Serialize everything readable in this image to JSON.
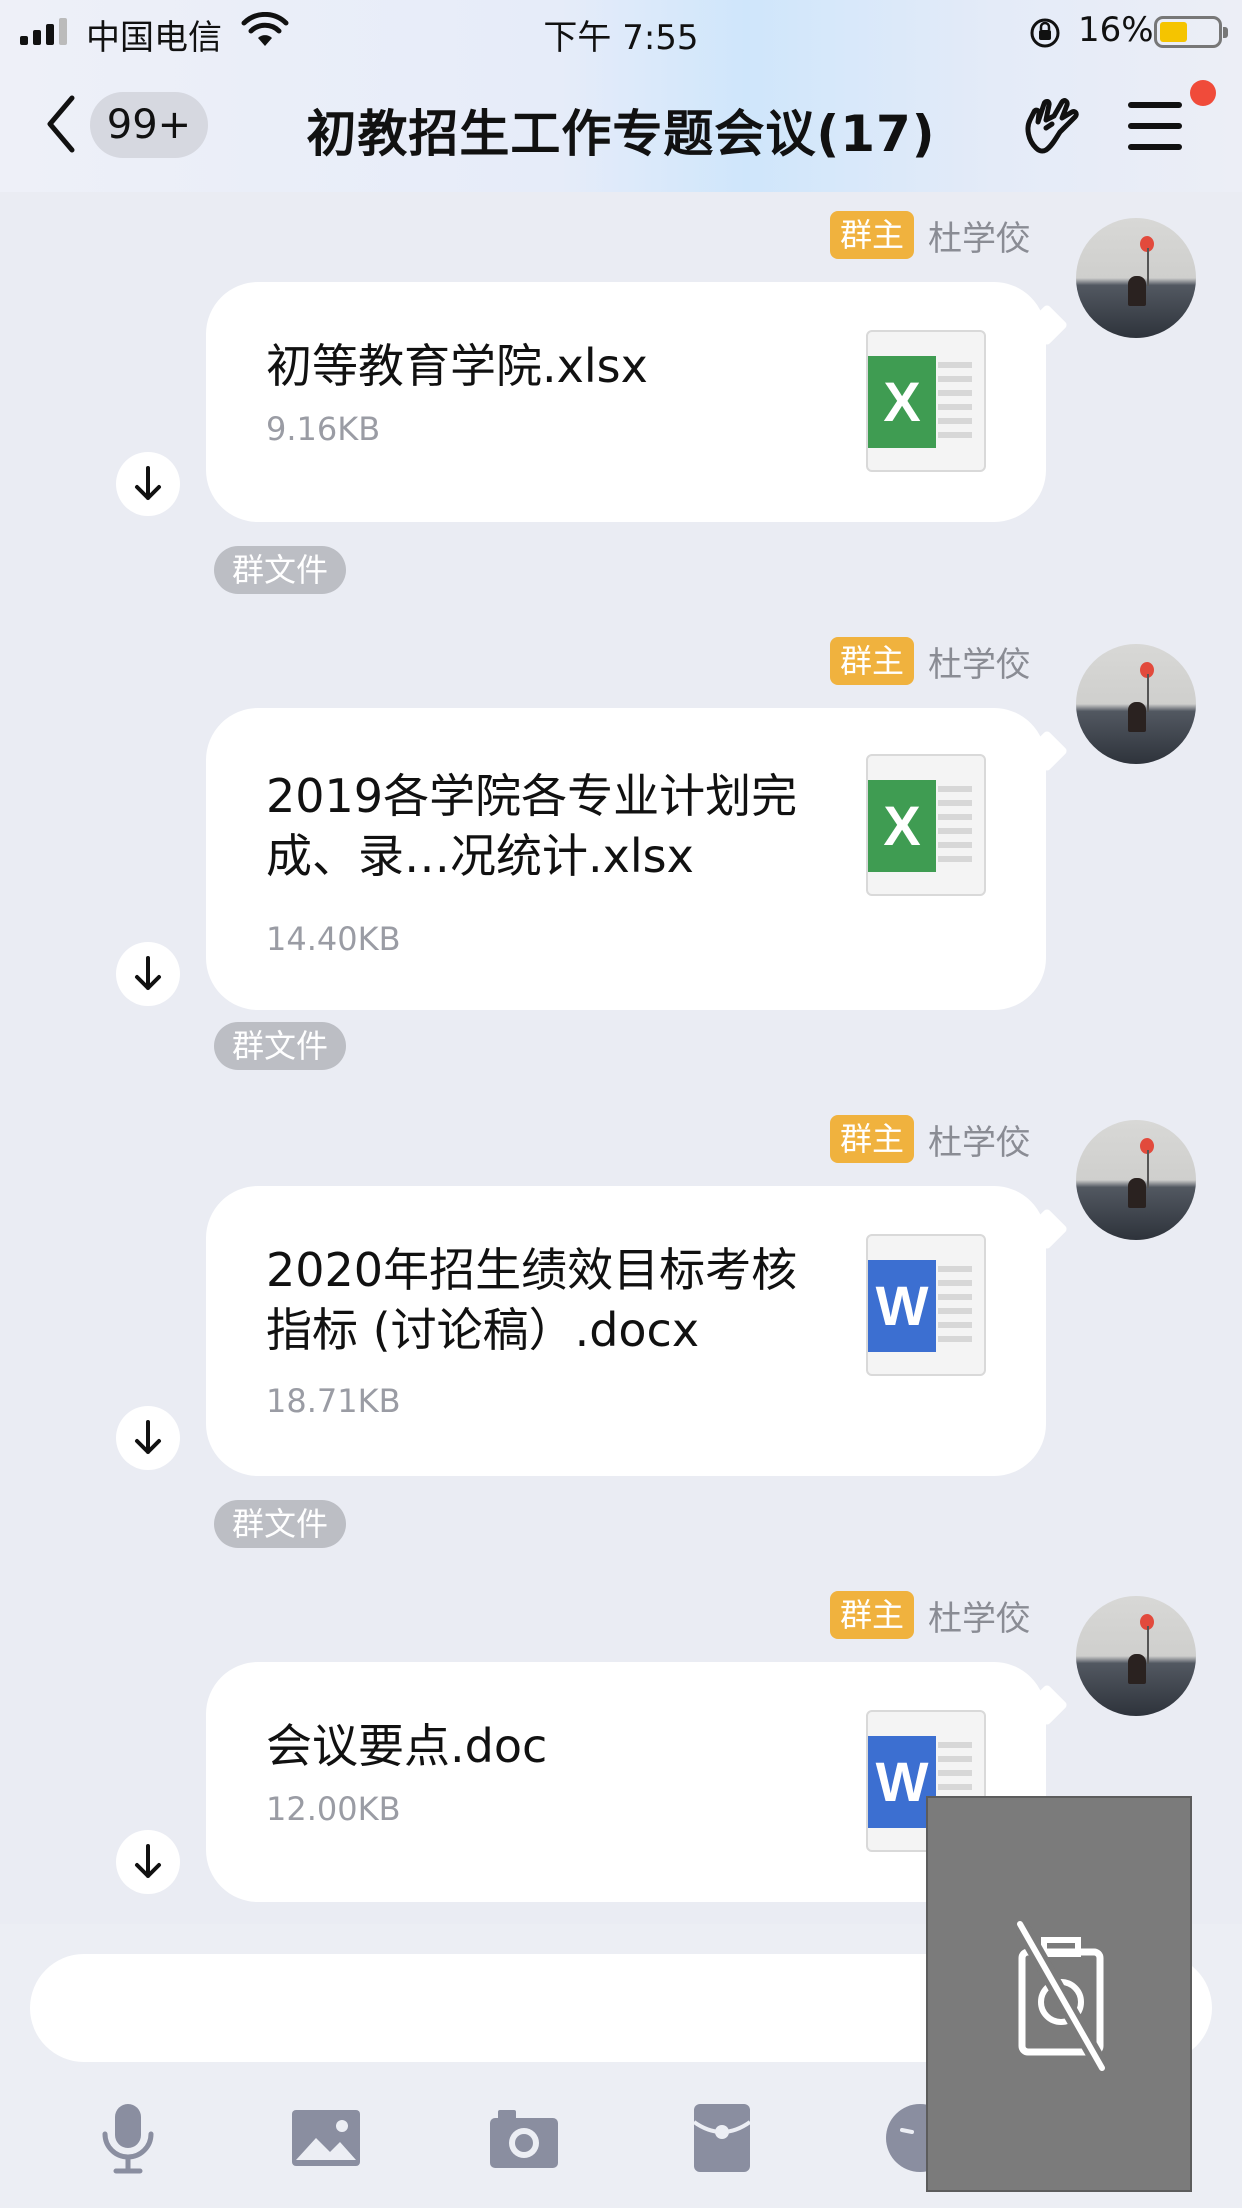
{
  "status_bar": {
    "carrier": "中国电信",
    "time": "下午 7:55",
    "battery_percent": "16%",
    "battery_level": 0.16,
    "battery_color": "#f5c400"
  },
  "nav": {
    "back_icon": "chevron-left-icon",
    "unread_badge": "99+",
    "title": "初教招生工作专题会议(17)",
    "action_icon": "hand-gesture-icon",
    "menu_icon": "hamburger-menu-icon",
    "notification_dot_color": "#f04b3a"
  },
  "messages": [
    {
      "role_tag": "群主",
      "sender": "杜学佼",
      "file_name": "初等教育学院.xlsx",
      "file_size": "9.16KB",
      "file_type": "excel",
      "group_label": "群文件"
    },
    {
      "role_tag": "群主",
      "sender": "杜学佼",
      "file_name": "2019各学院各专业计划完成、录…况统计.xlsx",
      "file_size": "14.40KB",
      "file_type": "excel",
      "group_label": "群文件"
    },
    {
      "role_tag": "群主",
      "sender": "杜学佼",
      "file_name": "2020年招生绩效目标考核指标 (讨论稿）.docx",
      "file_size": "18.71KB",
      "file_type": "word",
      "group_label": "群文件"
    },
    {
      "role_tag": "群主",
      "sender": "杜学佼",
      "file_name": "会议要点.doc",
      "file_size": "12.00KB",
      "file_type": "word"
    }
  ],
  "file_icon_letters": {
    "excel": "X",
    "word": "W"
  },
  "colors": {
    "owner_tag": "#f0b23e",
    "excel": "#3f9c52",
    "word": "#3c6fd1"
  },
  "toolbar": [
    "microphone-icon",
    "image-icon",
    "camera-icon",
    "red-packet-icon",
    "emoji-icon"
  ],
  "video_overlay": {
    "icon": "camera-off-icon"
  }
}
